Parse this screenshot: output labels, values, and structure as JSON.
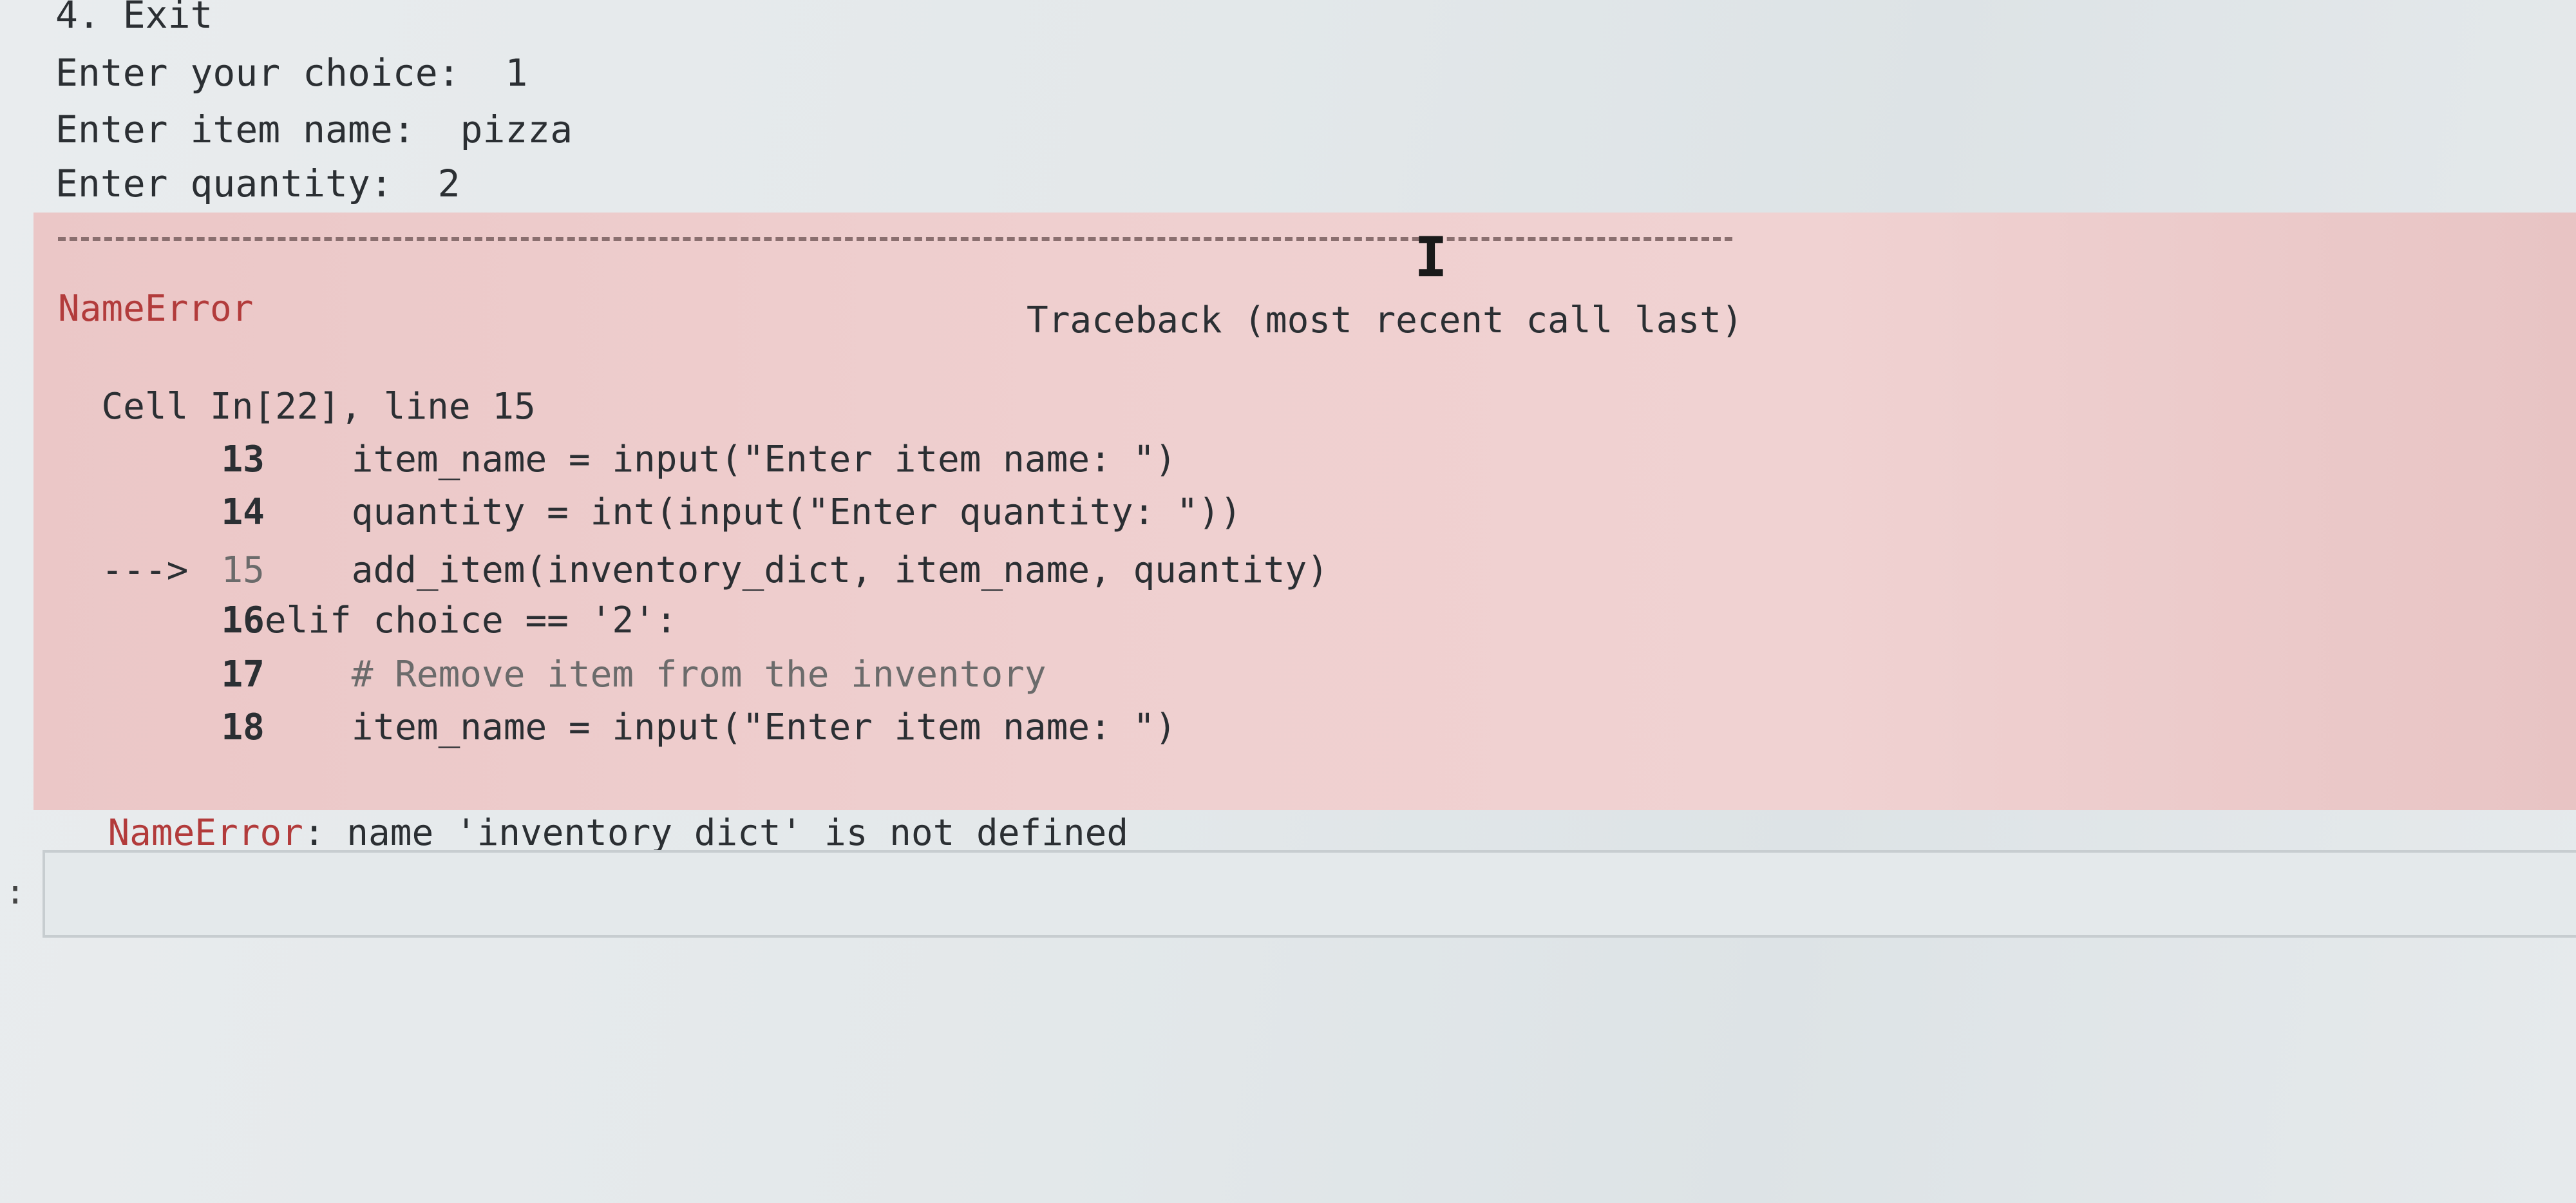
{
  "output": {
    "menu_exit": "4. Exit",
    "choice_prompt": "Enter your choice:  1",
    "item_prompt": "Enter item name:  pizza",
    "quantity_prompt": "Enter quantity:  2"
  },
  "traceback": {
    "separator_text": "",
    "error_type": "NameError",
    "header": "Traceback (most recent call last)",
    "cell_location": "Cell In[22], line 15",
    "lines": [
      {
        "arrow": "",
        "number": "13",
        "code": "    item_name = input(\"Enter item name: \")"
      },
      {
        "arrow": "",
        "number": "14",
        "code": "    quantity = int(input(\"Enter quantity: \"))"
      },
      {
        "arrow": "--->",
        "number": "15",
        "code": "    add_item(inventory_dict, item_name, quantity)"
      },
      {
        "arrow": "",
        "number": "16",
        "code": "elif choice == '2':"
      },
      {
        "arrow": "",
        "number": "17",
        "code": "    # Remove item from the inventory"
      },
      {
        "arrow": "",
        "number": "18",
        "code": "    item_name = input(\"Enter item name: \")"
      }
    ],
    "final_error_type": "NameError",
    "final_error_message": ": name 'inventory_dict' is not defined"
  },
  "input_cell": {
    "prompt": ":",
    "value": ""
  },
  "colors": {
    "error_bg": "#efcdcd",
    "error_red": "#b23b3b",
    "page_bg": "#e3e8ea"
  }
}
